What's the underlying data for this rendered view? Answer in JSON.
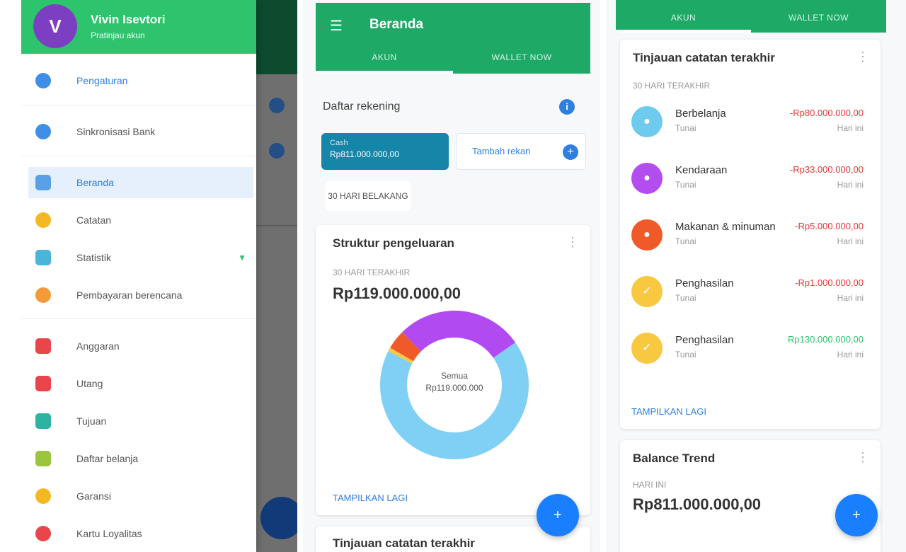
{
  "drawer": {
    "avatar_letter": "V",
    "user_name": "Vivin Isevtori",
    "user_sub": "Pratinjau akun",
    "items": [
      {
        "label": "Pengaturan",
        "icon": "settings-icon",
        "color": "#3f8fe8"
      },
      {
        "label": "Sinkronisasi Bank",
        "icon": "bank-sync-icon",
        "color": "#3f8fe8"
      },
      {
        "label": "Beranda",
        "icon": "home-icon",
        "color": "#5aa0e6"
      },
      {
        "label": "Catatan",
        "icon": "notes-icon",
        "color": "#f5b825"
      },
      {
        "label": "Statistik",
        "icon": "chart-icon",
        "color": "#4ab5d8"
      },
      {
        "label": "Pembayaran berencana",
        "icon": "planned-payment-icon",
        "color": "#f39a3a"
      },
      {
        "label": "Anggaran",
        "icon": "budget-icon",
        "color": "#e8464b"
      },
      {
        "label": "Utang",
        "icon": "debt-icon",
        "color": "#e8464b"
      },
      {
        "label": "Tujuan",
        "icon": "goal-icon",
        "color": "#2eb3a3"
      },
      {
        "label": "Daftar belanja",
        "icon": "shopping-list-icon",
        "color": "#9bc53d"
      },
      {
        "label": "Garansi",
        "icon": "warranty-icon",
        "color": "#f5b825"
      },
      {
        "label": "Kartu Loyalitas",
        "icon": "loyalty-card-icon",
        "color": "#e8464b"
      }
    ]
  },
  "home": {
    "title": "Beranda",
    "tabs": [
      "AKUN",
      "WALLET NOW"
    ],
    "accounts_title": "Daftar rekening",
    "account_chip": {
      "name": "Cash",
      "balance": "Rp811.000.000,00"
    },
    "add_account": "Tambah rekan",
    "date_range": "30 HARI BELAKANG",
    "spending": {
      "title": "Struktur pengeluaran",
      "period": "30 HARI TERAKHIR",
      "total": "Rp119.000.000,00",
      "center_label": "Semua",
      "center_value": "Rp119.000.000",
      "link": "TAMPILKAN LAGI"
    },
    "next_card_title": "Tinjauan catatan terakhir"
  },
  "tx": {
    "tabs": [
      "AKUN",
      "WALLET NOW"
    ],
    "card_title": "Tinjauan catatan terakhir",
    "period": "30 HARI TERAKHIR",
    "items": [
      {
        "name": "Berbelanja",
        "account": "Tunai",
        "amount": "-Rp80.000.000,00",
        "date": "Hari ini",
        "color": "#6fcbee",
        "icon": "shopping-icon",
        "positive": false
      },
      {
        "name": "Kendaraan",
        "account": "Tunai",
        "amount": "-Rp33.000.000,00",
        "date": "Hari ini",
        "color": "#b34df0",
        "icon": "vehicle-icon",
        "positive": false
      },
      {
        "name": "Makanan & minuman",
        "account": "Tunai",
        "amount": "-Rp5.000.000,00",
        "date": "Hari ini",
        "color": "#f05a28",
        "icon": "food-icon",
        "positive": false
      },
      {
        "name": "Penghasilan",
        "account": "Tunai",
        "amount": "-Rp1.000.000,00",
        "date": "Hari ini",
        "color": "#f7c840",
        "icon": "income-icon",
        "positive": false
      },
      {
        "name": "Penghasilan",
        "account": "Tunai",
        "amount": "Rp130.000.000,00",
        "date": "Hari ini",
        "color": "#f7c840",
        "icon": "income-icon",
        "positive": true
      }
    ],
    "link": "TAMPILKAN LAGI",
    "balance": {
      "title": "Balance Trend",
      "period": "HARI INI",
      "value": "Rp811.000.000,00"
    }
  },
  "chart_data": {
    "type": "pie",
    "variant": "donut",
    "categories": [
      "Berbelanja",
      "Kendaraan",
      "Makanan & minuman",
      "Penghasilan"
    ],
    "values": [
      80,
      33,
      5,
      1
    ],
    "colors": [
      "#7fd0f4",
      "#b24af2",
      "#f05a28",
      "#f7c840"
    ]
  }
}
